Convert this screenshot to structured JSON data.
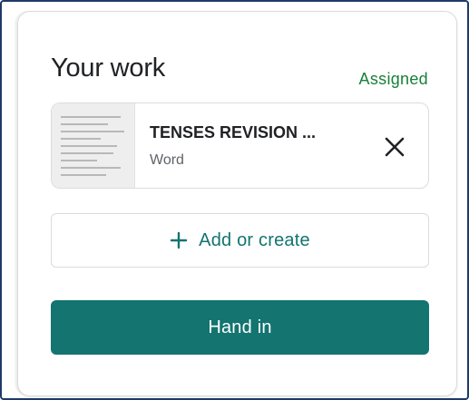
{
  "your_work": {
    "title": "Your work",
    "status": "Assigned",
    "status_color": "#188038"
  },
  "attachment": {
    "title": "TENSES REVISION ...",
    "type": "Word",
    "thumbnail": "document-thumbnail",
    "remove_icon": "close-icon"
  },
  "actions": {
    "add_label": "Add or create",
    "add_icon": "plus-icon",
    "hand_in_label": "Hand in",
    "accent_color": "#137470"
  }
}
